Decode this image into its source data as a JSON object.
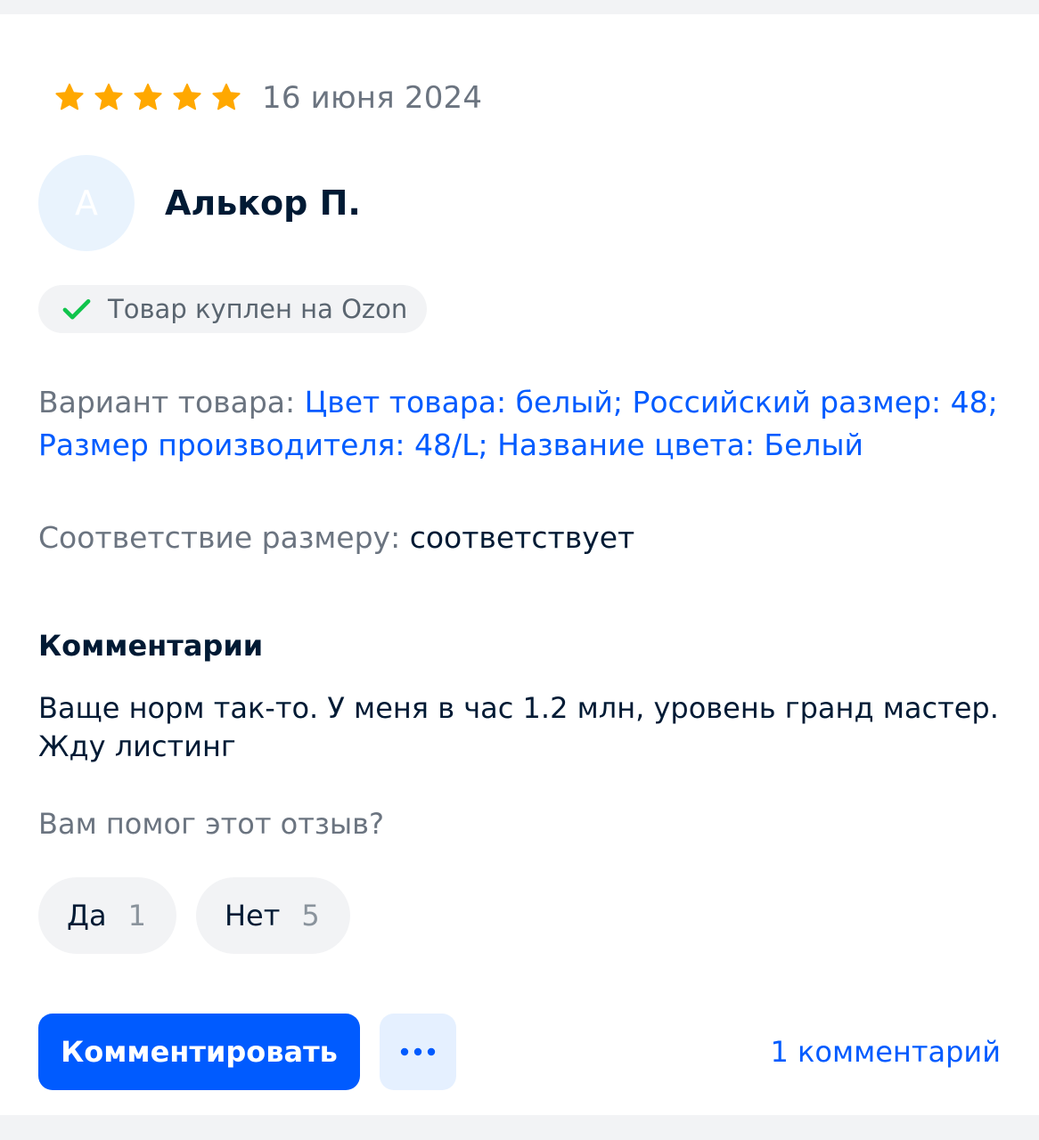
{
  "review": {
    "rating": 5,
    "rating_max": 5,
    "star_color": "#ffa800",
    "date": "16 июня 2024",
    "author": {
      "initial": "А",
      "name": "Алькор П."
    },
    "purchased_badge": "Товар куплен на Ozon",
    "variant": {
      "label": "Вариант товара: ",
      "value": "Цвет товара: белый; Российский размер: 48; Размер производителя: 48/L; Название цвета: Белый"
    },
    "size_fit": {
      "label": "Соответствие размеру: ",
      "value": "соответствует"
    },
    "comments_title": "Комментарии",
    "comment_text": "Ваще норм так-то. У меня в час 1.2 млн, уровень гранд мастер. Жду листинг",
    "helpful": {
      "question": "Вам помог этот отзыв?",
      "yes_label": "Да",
      "yes_count": "1",
      "no_label": "Нет",
      "no_count": "5"
    },
    "actions": {
      "comment_button": "Комментировать",
      "more_icon": "ellipsis-icon",
      "comments_link": "1 комментарий"
    }
  },
  "colors": {
    "accent": "#005bff",
    "check": "#10c44c",
    "muted_text": "#6b7480",
    "primary_text": "#001a34"
  }
}
